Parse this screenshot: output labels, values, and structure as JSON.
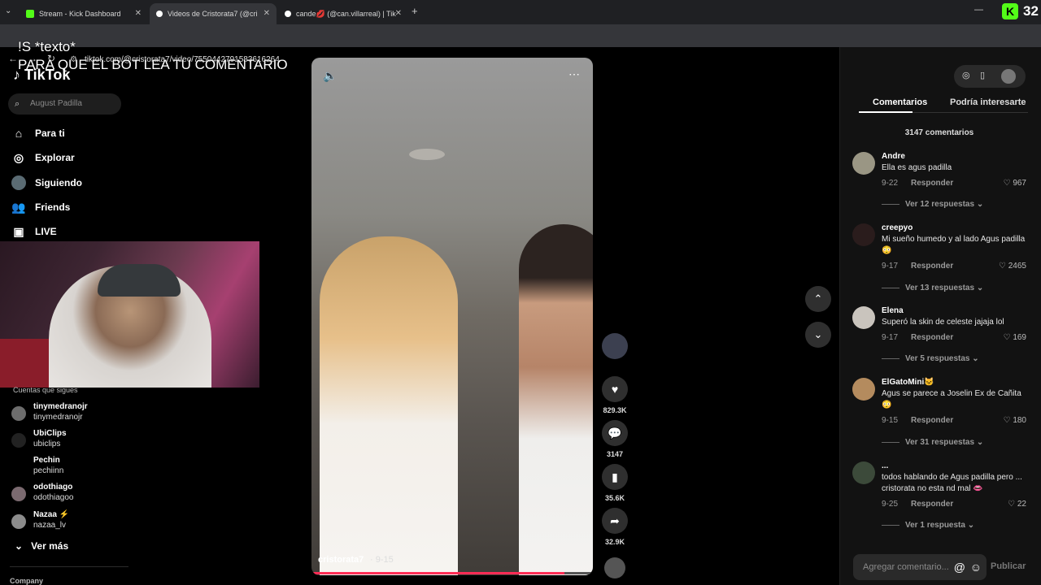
{
  "browser": {
    "tabs": [
      {
        "title": "Stream - Kick Dashboard",
        "color": "#53fc18"
      },
      {
        "title": "Videos de Cristorata7 (@cri",
        "color": "#ffffff"
      },
      {
        "title": "cande💋 (@can.villarreal) | Tik",
        "color": "#ffffff"
      }
    ],
    "new_tab": "+",
    "url": "tiktok.com/@cristorata7/video/7550442791583616264",
    "kick_count": "32",
    "kick_logo": "K"
  },
  "overlay": {
    "line1": "!S *texto*",
    "line2": "PARA  QUE EL BOT LEA TU COMENTARIO"
  },
  "sidebar": {
    "logo": "TikTok",
    "search_placeholder": "August Padilla",
    "items": [
      {
        "label": "Para ti",
        "icon": "home-icon"
      },
      {
        "label": "Explorar",
        "icon": "compass-icon"
      },
      {
        "label": "Siguiendo",
        "icon": "following-icon"
      },
      {
        "label": "Friends",
        "icon": "friends-icon"
      },
      {
        "label": "LIVE",
        "icon": "live-icon"
      }
    ],
    "following_title": "Cuentas que sigues",
    "accounts": [
      {
        "name": "tinymedranojr",
        "handle": "tinymedranojr"
      },
      {
        "name": "UbiClips",
        "handle": "ubiclips"
      },
      {
        "name": "Pechin",
        "handle": "pechiinn"
      },
      {
        "name": "odothiago",
        "handle": "odothiagoo"
      },
      {
        "name": "Nazaa ⚡",
        "handle": "nazaa_lv"
      }
    ],
    "ver_mas": "Ver más",
    "company": "Company"
  },
  "video": {
    "author": "cristorata7",
    "date": "· 9-15",
    "progress": 0.9,
    "likes": "829.3K",
    "comments": "3147",
    "saves": "35.6K",
    "shares": "32.9K"
  },
  "comments_panel": {
    "tab_comments": "Comentarios",
    "tab_interest": "Podría interesarte",
    "count": "3147 comentarios",
    "items": [
      {
        "user": "Andre",
        "text": "Ella es agus padilla",
        "date": "9-22",
        "reply": "Responder",
        "likes": "967",
        "replies": "Ver 12 respuestas"
      },
      {
        "user": "creepyo",
        "text": "Mi sueño humedo y al lado Agus padilla 😳",
        "date": "9-17",
        "reply": "Responder",
        "likes": "2465",
        "replies": "Ver 13 respuestas"
      },
      {
        "user": "Elena",
        "text": "Superó la skin de celeste jajaja lol",
        "date": "9-17",
        "reply": "Responder",
        "likes": "169",
        "replies": "Ver 5 respuestas"
      },
      {
        "user": "ElGatoMini🐱",
        "text": "Agus se parece a Joselin Ex de Cañita 😳",
        "date": "9-15",
        "reply": "Responder",
        "likes": "180",
        "replies": "Ver 31 respuestas"
      },
      {
        "user": "...",
        "text": "todos hablando de Agus padilla pero ... cristorata no esta nd mal 👄",
        "date": "9-25",
        "reply": "Responder",
        "likes": "22",
        "replies": "Ver 1 respuesta"
      }
    ],
    "input_placeholder": "Agregar comentario...",
    "publish": "Publicar"
  }
}
